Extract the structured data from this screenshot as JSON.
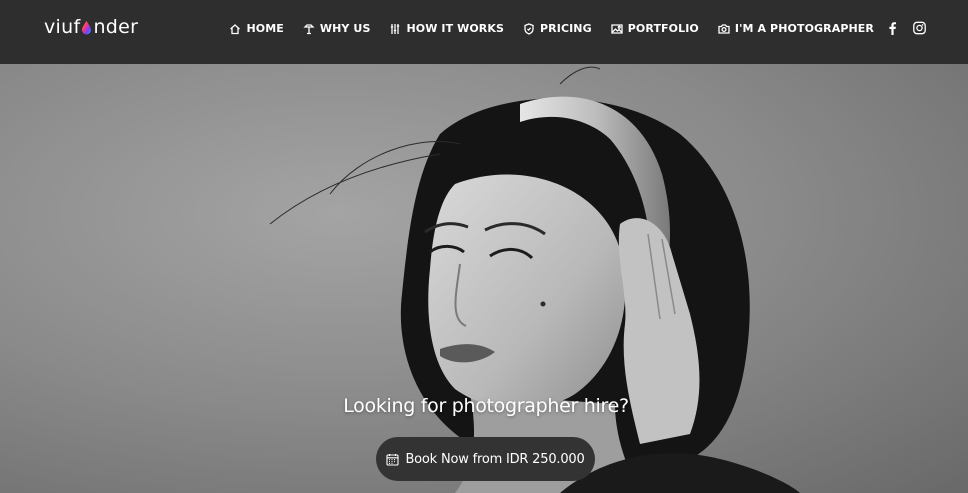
{
  "brand": {
    "logo_prefix": "viuf",
    "logo_suffix": "nder"
  },
  "nav": {
    "items": [
      {
        "label": "HOME",
        "icon": "home-icon"
      },
      {
        "label": "WHY US",
        "icon": "lamp-icon"
      },
      {
        "label": "HOW IT WORKS",
        "icon": "sliders-icon"
      },
      {
        "label": "PRICING",
        "icon": "shield-icon"
      },
      {
        "label": "PORTFOLIO",
        "icon": "image-icon"
      },
      {
        "label": "I'M A PHOTOGRAPHER",
        "icon": "camera-icon"
      }
    ],
    "social": [
      "facebook-icon",
      "instagram-icon"
    ]
  },
  "hero": {
    "headline": "Looking for photographer hire?",
    "cta_label": "Book Now from IDR 250.000",
    "cta_icon": "calendar-icon"
  },
  "colors": {
    "navbar": "#2e2e2e",
    "button": "#333333",
    "text": "#ffffff"
  }
}
